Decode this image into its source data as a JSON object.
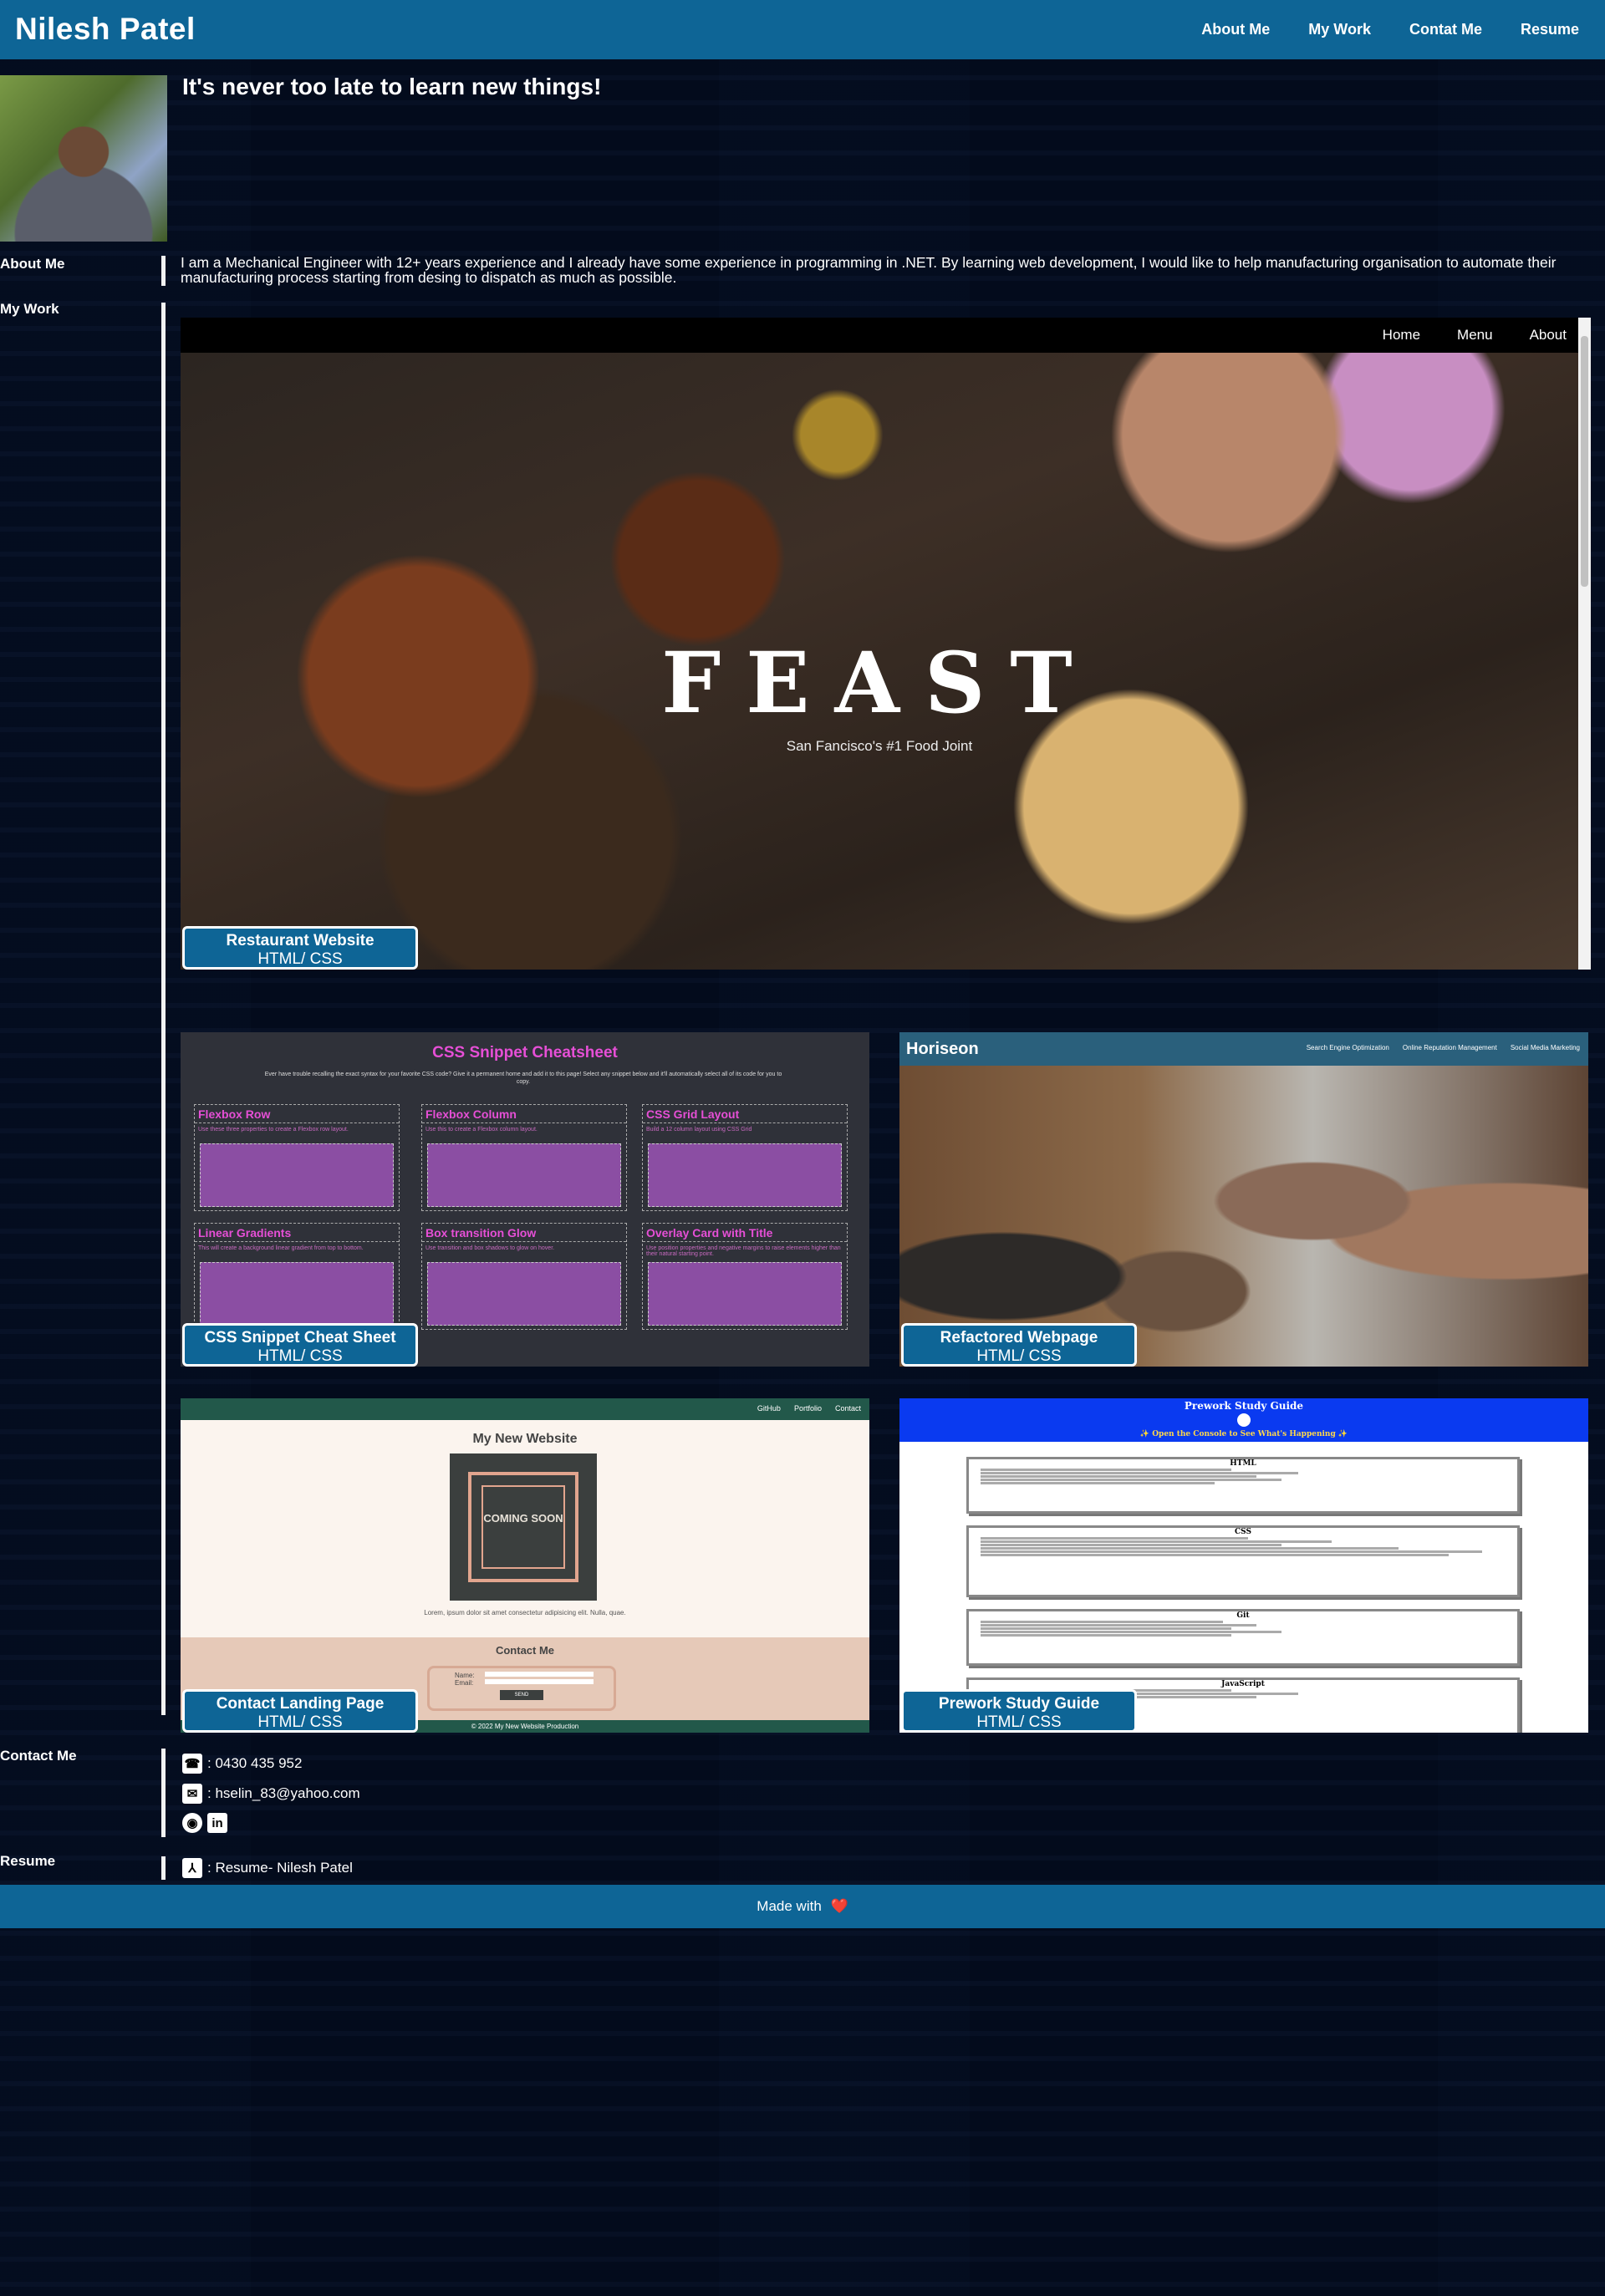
{
  "header": {
    "brand": "Nilesh Patel",
    "nav": [
      "About Me",
      "My Work",
      "Contat Me",
      "Resume"
    ]
  },
  "hero": {
    "tagline": "It's never too late to learn new things!"
  },
  "about": {
    "label": "About Me",
    "text": "I am a Mechanical Engineer with 12+ years experience and I already have some experience in programming in .NET. By learning web development, I would like to help manufacturing organisation to automate their manufacturing process starting from desing to dispatch as much as possible."
  },
  "work": {
    "label": "My Work",
    "projects": [
      {
        "name": "Restaurant Website",
        "tech": "HTML/ CSS",
        "preview": {
          "nav": [
            "Home",
            "Menu",
            "About"
          ],
          "title": "FEAST",
          "subtitle": "San Fancisco's #1 Food Joint"
        }
      },
      {
        "name": "CSS Snippet Cheat Sheet",
        "tech": "HTML/ CSS",
        "preview": {
          "title": "CSS Snippet Cheatsheet",
          "intro": "Ever have trouble recalling the exact syntax for your favorite CSS code? Give it a permanent home and add it to this page! Select any snippet below and it'll automatically select all of its code for you to copy.",
          "cards": [
            {
              "title": "Flexbox Row",
              "desc": "Use these three properties to create a Flexbox row layout."
            },
            {
              "title": "Flexbox Column",
              "desc": "Use this to create a Flexbox column layout."
            },
            {
              "title": "CSS Grid Layout",
              "desc": "Build a 12 column layout using CSS Grid"
            },
            {
              "title": "Linear Gradients",
              "desc": "This will create a background linear gradient from top to bottom."
            },
            {
              "title": "Box transition Glow",
              "desc": "Use transition and box shadows to glow on hover."
            },
            {
              "title": "Overlay Card with Title",
              "desc": "Use position properties and negative margins to raise elements higher than their natural starting point."
            }
          ]
        }
      },
      {
        "name": "Refactored Webpage",
        "tech": "HTML/ CSS",
        "preview": {
          "logo": "Horiseon",
          "nav": [
            "Search Engine Optimization",
            "Online Reputation Management",
            "Social Media Marketing"
          ]
        }
      },
      {
        "name": "Contact Landing Page",
        "tech": "HTML/ CSS",
        "preview": {
          "nav": [
            "GitHub",
            "Portfolio",
            "Contact"
          ],
          "title": "My New Website",
          "coming_soon": "COMING SOON",
          "lorem": "Lorem, ipsum dolor sit amet consectetur adipisicing elit. Nulla, quae.",
          "contact_heading": "Contact Me",
          "name_label": "Name:",
          "email_label": "Email:",
          "send": "SEND",
          "footer": "© 2022 My New Website Production"
        }
      },
      {
        "name": "Prework Study Guide",
        "tech": "HTML/ CSS",
        "preview": {
          "title": "Prework Study Guide",
          "subtitle": "✨ Open the Console to See What's Happening ✨",
          "sections": [
            "HTML",
            "CSS",
            "Git",
            "JavaScript"
          ]
        }
      }
    ]
  },
  "contact": {
    "label": "Contact Me",
    "phone": ": 0430 435 952",
    "email": ": hselin_83@yahoo.com"
  },
  "resume": {
    "label": "Resume",
    "link": ": Resume- Nilesh Patel"
  },
  "footer": {
    "text": "Made with",
    "heart": "❤️"
  }
}
